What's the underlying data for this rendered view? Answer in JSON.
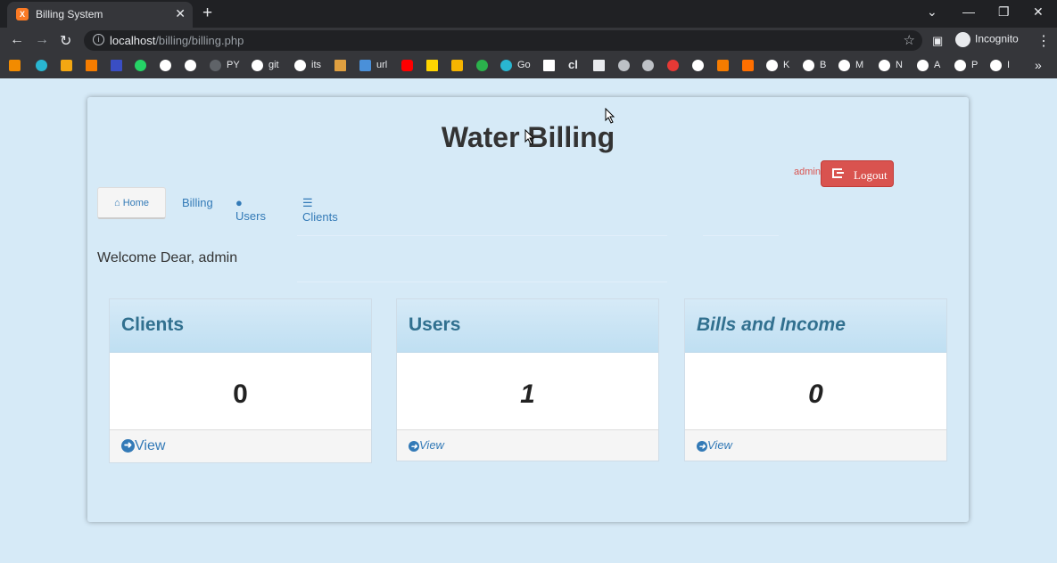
{
  "browser": {
    "tab_title": "Billing System",
    "tab_close": "✕",
    "new_tab": "+",
    "url_host": "localhost",
    "url_path": "/billing/billing.php",
    "incognito_label": "Incognito",
    "window_min": "—",
    "window_restore": "❐",
    "window_close": "✕",
    "back": "←",
    "forward": "→",
    "reload": "↻",
    "menu": "⋮",
    "star": "☆",
    "more": "»",
    "bookmarks": [
      "PY",
      "git",
      "its",
      "url",
      "Go",
      "cl",
      "K",
      "B",
      "M",
      "N",
      "A",
      "P",
      "I"
    ]
  },
  "page": {
    "title": "Water Billing",
    "user_label": "admin",
    "logout_label": "Logout",
    "nav": {
      "home": "Home",
      "billing": "Billing",
      "users": "Users",
      "clients": "Clients"
    },
    "welcome": "Welcome Dear, admin",
    "cards": [
      {
        "heading": "Clients",
        "count": "0",
        "link": "View"
      },
      {
        "heading": "Users",
        "count": "1",
        "link": "View"
      },
      {
        "heading": "Bills and Income",
        "count": "0",
        "link": "View"
      }
    ]
  },
  "colors": {
    "page_bg": "#d6eaf7",
    "logout_bg": "#d9534f",
    "link": "#337ab7",
    "card_heading": "#31708f"
  }
}
